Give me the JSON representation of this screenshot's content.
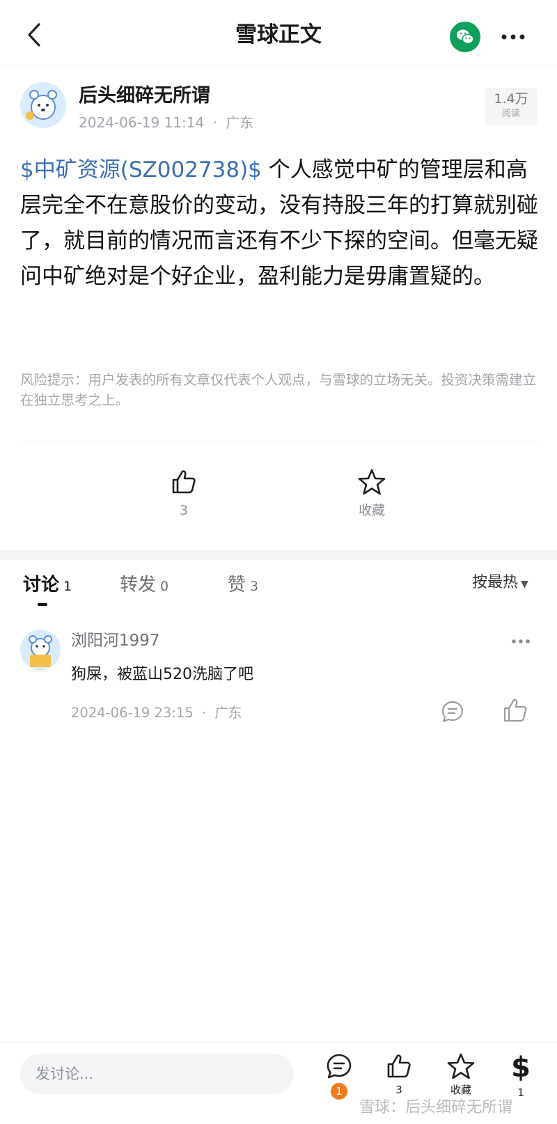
{
  "header": {
    "title": "雪球正文"
  },
  "author": {
    "name": "后头细碎无所谓",
    "date": "2024-06-19 11:14",
    "separator": "·",
    "location": "广东",
    "views_count": "1.4万",
    "views_label": "阅读"
  },
  "post": {
    "stock_tag": "$中矿资源(SZ002738)$",
    "text": " 个人感觉中矿的管理层和高层完全不在意股价的变动，没有持股三年的打算就别碰了，就目前的情况而言还有不少下探的空间。但毫无疑问中矿绝对是个好企业，盈利能力是毋庸置疑的。",
    "disclaimer": "风险提示：用户发表的所有文章仅代表个人观点，与雪球的立场无关。投资决策需建立在独立思考之上。"
  },
  "actions": {
    "like_count": "3",
    "favorite_label": "收藏"
  },
  "tabs": [
    {
      "label": "讨论",
      "count": "1"
    },
    {
      "label": "转发",
      "count": "0"
    },
    {
      "label": "赞",
      "count": "3"
    }
  ],
  "sort": {
    "label": "按最热",
    "caret": "▼"
  },
  "comments": [
    {
      "user": "浏阳河1997",
      "text": "狗屎，被蓝山520洗脑了吧",
      "date": "2024-06-19 23:15",
      "separator": "·",
      "location": "广东"
    }
  ],
  "bottom_bar": {
    "input_placeholder": "发讨论...",
    "discuss_badge": "1",
    "like_count": "3",
    "favorite_label": "收藏",
    "reward_symbol": "$",
    "reward_count": "1"
  },
  "watermark": "雪球：后头细碎无所谓",
  "colors": {
    "link": "#3b6fb2",
    "wechat": "#0fa05e",
    "badge": "#f27c1c"
  }
}
